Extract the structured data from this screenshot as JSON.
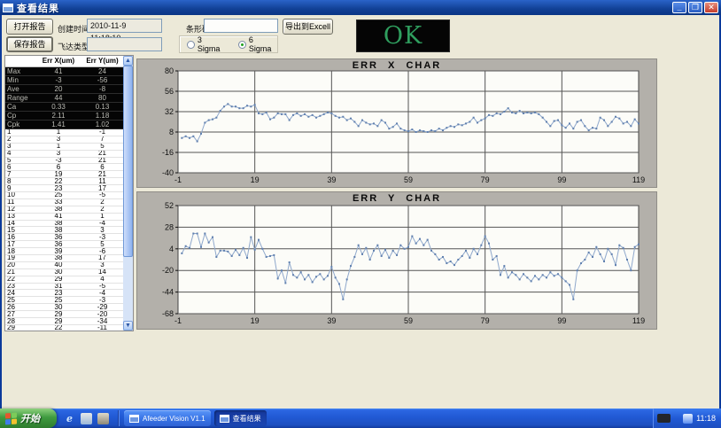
{
  "window": {
    "title": "查看结果"
  },
  "toolbar": {
    "open_report": "打开报告",
    "save_report": "保存报告",
    "created_label": "创建时间",
    "created_value": "2010-11-9 11:18:10",
    "feeder_label": "飞达类型",
    "feeder_value": "",
    "barcode_label": "条形码",
    "barcode_value": "",
    "export_excel": "导出到Excell",
    "radio_3sigma": "3 Sigma",
    "radio_6sigma": "6 Sigma",
    "selected_sigma": "6 Sigma"
  },
  "status": {
    "text": "OK",
    "color": "#2f9e5e"
  },
  "table": {
    "headers": [
      "",
      "Err X(um)",
      "Err Y(um)"
    ],
    "stats": [
      [
        "Max",
        "41",
        "24"
      ],
      [
        "Min",
        "-3",
        "-56"
      ],
      [
        "Ave",
        "20",
        "-8"
      ],
      [
        "Range",
        "44",
        "80"
      ],
      [
        "Ca",
        "0.33",
        "0.13"
      ],
      [
        "Cp",
        "2.11",
        "1.18"
      ],
      [
        "Cpk",
        "1.41",
        "1.02"
      ]
    ],
    "rows": [
      [
        "1",
        "1",
        "-1"
      ],
      [
        "2",
        "3",
        "7"
      ],
      [
        "3",
        "1",
        "5"
      ],
      [
        "4",
        "3",
        "21"
      ],
      [
        "5",
        "-3",
        "21"
      ],
      [
        "6",
        "6",
        "6"
      ],
      [
        "7",
        "19",
        "21"
      ],
      [
        "8",
        "22",
        "11"
      ],
      [
        "9",
        "23",
        "17"
      ],
      [
        "10",
        "25",
        "-5"
      ],
      [
        "11",
        "33",
        "2"
      ],
      [
        "12",
        "38",
        "2"
      ],
      [
        "13",
        "41",
        "1"
      ],
      [
        "14",
        "38",
        "-4"
      ],
      [
        "15",
        "38",
        "3"
      ],
      [
        "16",
        "36",
        "-3"
      ],
      [
        "17",
        "36",
        "5"
      ],
      [
        "18",
        "39",
        "-6"
      ],
      [
        "19",
        "38",
        "17"
      ],
      [
        "20",
        "40",
        "3"
      ],
      [
        "21",
        "30",
        "14"
      ],
      [
        "22",
        "29",
        "4"
      ],
      [
        "23",
        "31",
        "-5"
      ],
      [
        "24",
        "23",
        "-4"
      ],
      [
        "25",
        "25",
        "-3"
      ],
      [
        "26",
        "30",
        "-29"
      ],
      [
        "27",
        "29",
        "-20"
      ],
      [
        "28",
        "29",
        "-34"
      ],
      [
        "29",
        "22",
        "-11"
      ]
    ]
  },
  "chart_data": [
    {
      "type": "line",
      "title": "ERR X CHAR",
      "xlabel": "",
      "ylabel": "",
      "xlim": [
        -1,
        119
      ],
      "ylim": [
        -40,
        80
      ],
      "x_ticks": [
        -1,
        19,
        39,
        59,
        79,
        99,
        119
      ],
      "y_ticks": [
        80,
        56,
        32,
        8,
        -16,
        -40
      ],
      "grid": true,
      "line_color": "#8fa8cc",
      "marker_color": "#5f7fae",
      "values": [
        1,
        3,
        1,
        3,
        -3,
        6,
        19,
        22,
        23,
        25,
        33,
        38,
        41,
        38,
        38,
        36,
        36,
        39,
        38,
        40,
        30,
        29,
        31,
        23,
        25,
        30,
        29,
        29,
        22,
        28,
        30,
        27,
        29,
        26,
        28,
        25,
        27,
        29,
        31,
        30,
        27,
        25,
        26,
        22,
        24,
        20,
        15,
        22,
        19,
        17,
        18,
        15,
        22,
        19,
        12,
        14,
        18,
        12,
        10,
        9,
        11,
        8,
        10,
        9,
        8,
        10,
        9,
        12,
        10,
        13,
        15,
        14,
        17,
        16,
        18,
        20,
        25,
        19,
        22,
        24,
        28,
        27,
        30,
        29,
        32,
        36,
        31,
        30,
        33,
        30,
        31,
        30,
        31,
        29,
        25,
        20,
        15,
        21,
        22,
        16,
        13,
        18,
        12,
        20,
        22,
        15,
        10,
        13,
        12,
        25,
        22,
        15,
        20,
        26,
        24,
        18,
        20,
        15,
        23,
        18
      ]
    },
    {
      "type": "line",
      "title": "ERR Y CHAR",
      "xlabel": "",
      "ylabel": "",
      "xlim": [
        -1,
        119
      ],
      "ylim": [
        -68,
        52
      ],
      "x_ticks": [
        -1,
        19,
        39,
        59,
        79,
        99,
        119
      ],
      "y_ticks": [
        52,
        28,
        4,
        -20,
        -44,
        -68
      ],
      "grid": true,
      "line_color": "#8fa8cc",
      "marker_color": "#5f7fae",
      "values": [
        -1,
        7,
        5,
        21,
        21,
        6,
        21,
        11,
        17,
        -5,
        2,
        2,
        1,
        -4,
        3,
        -3,
        5,
        -6,
        17,
        3,
        14,
        4,
        -5,
        -4,
        -3,
        -29,
        -20,
        -34,
        -11,
        -25,
        -28,
        -22,
        -30,
        -25,
        -33,
        -27,
        -24,
        -30,
        -26,
        -16,
        -28,
        -35,
        -52,
        -30,
        -15,
        -5,
        8,
        -2,
        5,
        -8,
        2,
        8,
        -4,
        3,
        -6,
        2,
        -3,
        8,
        4,
        6,
        18,
        10,
        15,
        8,
        14,
        2,
        -2,
        -8,
        -5,
        -12,
        -10,
        -14,
        -8,
        -4,
        2,
        -6,
        4,
        -2,
        8,
        18,
        10,
        -8,
        -4,
        -25,
        -15,
        -28,
        -22,
        -25,
        -30,
        -24,
        -28,
        -32,
        -26,
        -30,
        -25,
        -28,
        -22,
        -26,
        -24,
        -28,
        -32,
        -36,
        -52,
        -20,
        -12,
        -8,
        0,
        -5,
        6,
        -2,
        -10,
        4,
        -2,
        -14,
        8,
        5,
        -8,
        -20,
        6,
        9
      ]
    }
  ],
  "taskbar": {
    "start_label": "开始",
    "tasks": [
      {
        "label": "Afeeder Vision V1.1",
        "active": false
      },
      {
        "label": "查看结果",
        "active": true
      }
    ],
    "clock": "11:18"
  }
}
